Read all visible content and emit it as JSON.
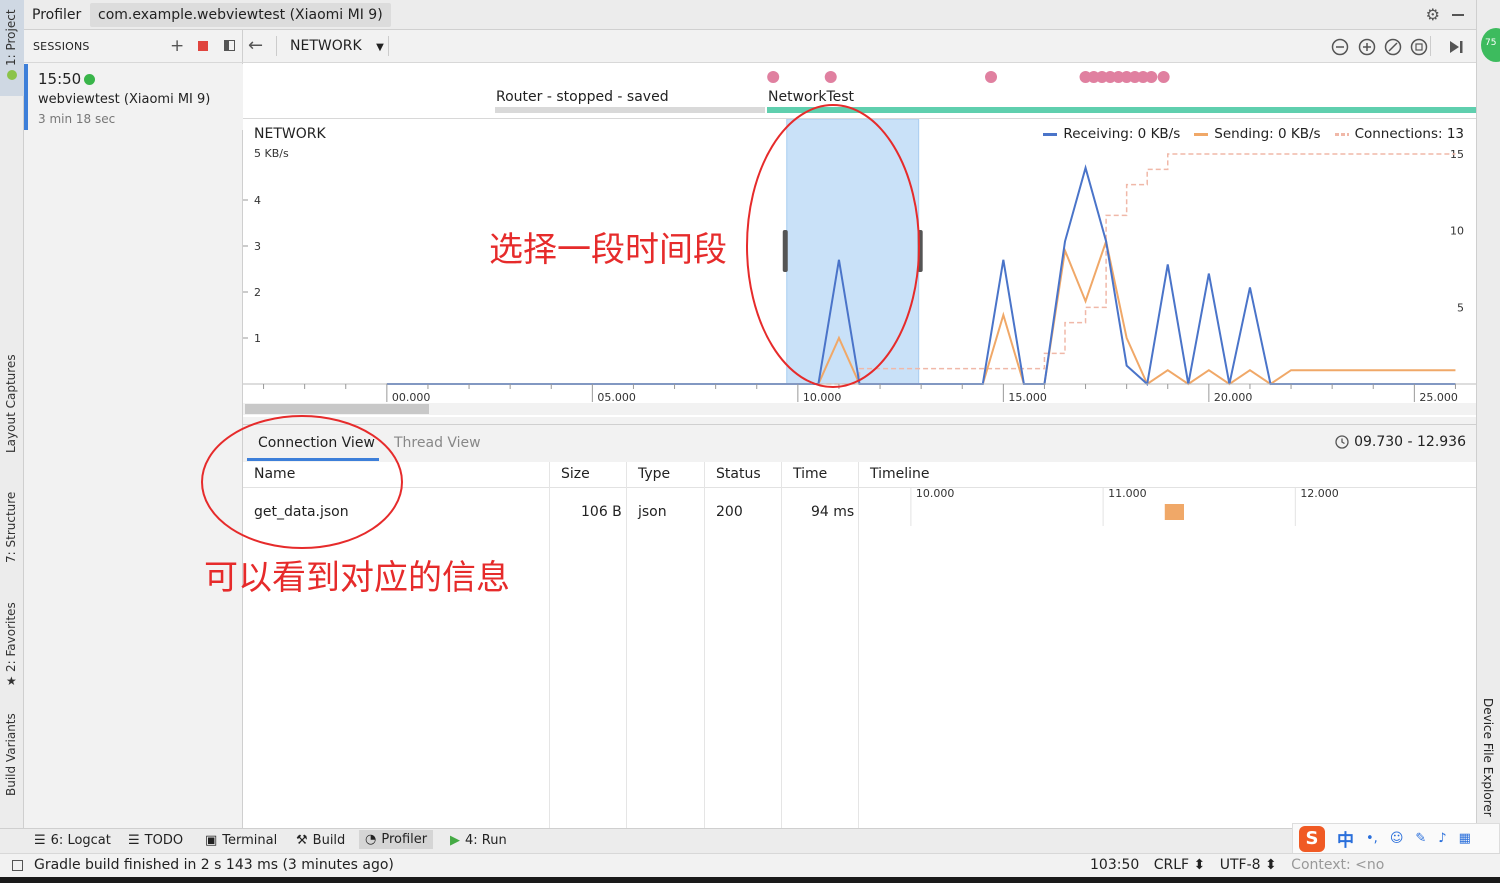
{
  "window": {
    "app_tab": "Profiler",
    "session_tab": "com.example.webviewtest (Xiaomi MI 9)"
  },
  "side_tabs": {
    "left": [
      "1: Project",
      "Layout Captures",
      "7: Structure",
      "2: Favorites",
      "Build Variants"
    ],
    "right": [
      "Device File Explorer"
    ],
    "badge": "75"
  },
  "sessions": {
    "label": "SESSIONS",
    "item": {
      "time": "15:50",
      "device": "webviewtest (Xiaomi MI 9)",
      "duration": "3 min 18 sec"
    }
  },
  "toolbar": {
    "profiler_label": "NETWORK"
  },
  "events": {
    "activities": [
      {
        "label": "Router - stopped - saved",
        "state": "stopped"
      },
      {
        "label": "NetworkTest",
        "state": "active"
      }
    ]
  },
  "network": {
    "title": "NETWORK",
    "legend": {
      "receiving": "Receiving: 0 KB/s",
      "sending": "Sending: 0 KB/s",
      "connections": "Connections: 13"
    },
    "colors": {
      "receiving": "#4a74c9",
      "sending": "#f0a868",
      "connections": "#f0b8a8",
      "selection": "#c9e1f8"
    }
  },
  "chart_data": {
    "type": "line",
    "title": "NETWORK",
    "x": [
      0.0,
      9.7,
      10.5,
      11.0,
      11.5,
      12.5,
      13.0,
      14.5,
      15.0,
      15.5,
      16.0,
      16.5,
      17.0,
      17.5,
      18.0,
      18.5,
      19.0,
      19.5,
      20.0,
      20.5,
      21.0,
      21.5,
      22.0,
      23.0,
      24.0,
      25.0,
      26.0
    ],
    "series": [
      {
        "name": "Receiving",
        "axis": "left",
        "values": [
          0,
          0,
          0,
          2.7,
          0,
          0,
          0,
          0,
          2.7,
          0,
          0,
          3.1,
          4.7,
          3.1,
          0.4,
          0,
          2.6,
          0,
          2.4,
          0,
          2.1,
          0,
          0,
          0,
          0,
          0,
          0
        ]
      },
      {
        "name": "Sending",
        "axis": "left",
        "values": [
          0,
          0,
          0,
          1.0,
          0,
          0,
          0,
          0,
          1.5,
          0,
          0,
          2.9,
          1.8,
          3.1,
          1.0,
          0,
          0.3,
          0,
          0.3,
          0,
          0.3,
          0,
          0.3,
          0.3,
          0.3,
          0.3,
          0.3
        ]
      },
      {
        "name": "Connections",
        "axis": "right",
        "values": [
          null,
          null,
          0,
          0,
          1,
          1,
          1,
          1,
          1,
          1,
          2,
          4,
          5,
          11,
          13,
          14,
          15,
          15,
          15,
          15,
          15,
          15,
          15,
          15,
          15,
          15,
          15
        ]
      }
    ],
    "x_tick_labels": [
      "00.000",
      "05.000",
      "10.000",
      "15.000",
      "20.000",
      "25.000"
    ],
    "x_ticks": [
      0,
      5,
      10,
      15,
      20,
      25
    ],
    "xlim": [
      -3.5,
      26.5
    ],
    "y_left_ticks": [
      1,
      2,
      3,
      4
    ],
    "y_left_top_label": "5 KB/s",
    "ylim": [
      0,
      5
    ],
    "y_right_ticks": [
      5,
      10,
      15
    ],
    "y_right_lim": [
      0,
      15
    ],
    "selection": [
      9.73,
      12.94
    ],
    "legend_position": "top-right"
  },
  "lower": {
    "tabs": {
      "connection": "Connection View",
      "thread": "Thread View"
    },
    "range": "09.730 - 12.936",
    "columns": {
      "name": "Name",
      "size": "Size",
      "type": "Type",
      "status": "Status",
      "time": "Time",
      "timeline": "Timeline"
    },
    "timeline_ticks": [
      "10.000",
      "11.000",
      "12.000"
    ],
    "rows": [
      {
        "name": "get_data.json",
        "size": "106 B",
        "type": "json",
        "status": "200",
        "time": "94 ms",
        "start": 11.3,
        "end": 11.4
      }
    ]
  },
  "annotations": {
    "select": "选择一段时间段",
    "info": "可以看到对应的信息"
  },
  "bottom_tools": {
    "logcat": "6: Logcat",
    "todo": "TODO",
    "terminal": "Terminal",
    "build": "Build",
    "profiler": "Profiler",
    "run": "4: Run"
  },
  "status": {
    "message": "Gradle build finished in 2 s 143 ms (3 minutes ago)",
    "position": "103:50",
    "line_sep": "CRLF",
    "encoding": "UTF-8",
    "context": "Context: <no"
  },
  "ime": {
    "lang": "中",
    "brand": "S"
  }
}
